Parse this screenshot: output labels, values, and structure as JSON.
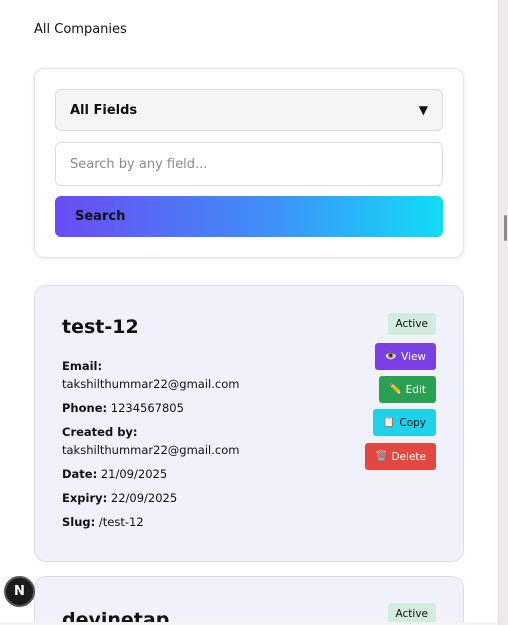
{
  "page": {
    "title": "All Companies"
  },
  "search": {
    "field_select_value": "All Fields",
    "dropdown_icon": "triangle-down",
    "placeholder": "Search by any field...",
    "button_label": "Search"
  },
  "companies": [
    {
      "name": "test-12",
      "status": "Active",
      "email_label": "Email:",
      "email": "takshilthummar22@gmail.com",
      "phone_label": "Phone:",
      "phone": "1234567805",
      "created_by_label": "Created by:",
      "created_by": "takshilthummar22@gmail.com",
      "date_label": "Date:",
      "date": "21/09/2025",
      "expiry_label": "Expiry:",
      "expiry": "22/09/2025",
      "slug_label": "Slug:",
      "slug": "/test-12",
      "actions": {
        "view_icon": "👁️",
        "view": "View",
        "edit_icon": "✏️",
        "edit": "Edit",
        "copy_icon": "📋",
        "copy": "Copy",
        "delete_icon": "🗑️",
        "delete": "Delete"
      }
    },
    {
      "name": "devinetap",
      "status": "Active"
    }
  ],
  "fab": {
    "label": "N"
  },
  "colors": {
    "view": "#7c3fe6",
    "edit": "#2aa052",
    "copy": "#1ed2ec",
    "delete": "#e34840",
    "badge": "#d3ece0",
    "card_bg": "#f0f1fb"
  }
}
